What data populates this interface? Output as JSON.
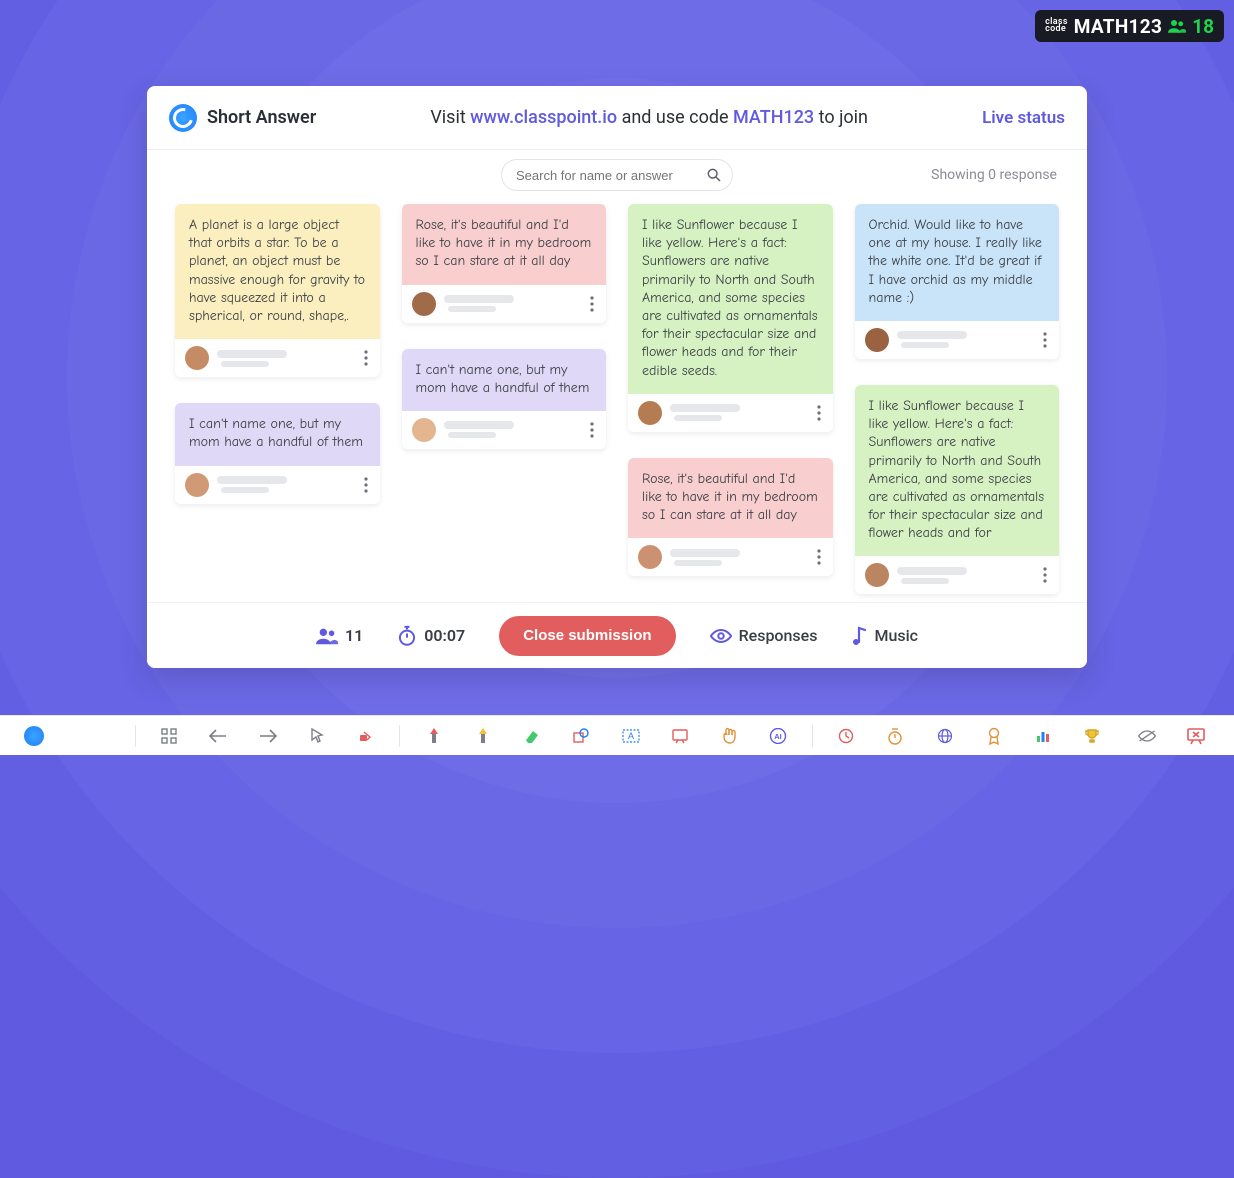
{
  "badge": {
    "label_top": "class",
    "label_bottom": "code",
    "code": "MATH123",
    "participants": "18"
  },
  "header": {
    "activity_title": "Short Answer",
    "instruction_prefix": "Visit ",
    "instruction_url": "www.classpoint.io",
    "instruction_mid": " and use code ",
    "instruction_code": "MATH123",
    "instruction_suffix": " to join",
    "live_status": "Live status"
  },
  "search": {
    "placeholder": "Search for name or answer",
    "showing_text": "Showing 0 response"
  },
  "responses": [
    {
      "color": "c-yellow",
      "text": "A planet is a large object that orbits a star. To be a planet, an object must be massive enough for gravity to have squeezed it into a spherical, or round, shape,."
    },
    {
      "color": "c-purple",
      "text": "I can't name one, but my mom have a handful of them"
    },
    {
      "color": "c-pink",
      "text": "Rose, it's beautiful and I'd like to have it in my bedroom so I can stare at it all day"
    },
    {
      "color": "c-purple",
      "text": "I can't name one, but my mom have a handful of them"
    },
    {
      "color": "c-green",
      "text": "I like Sunflower because I like yellow. Here's a fact: Sunflowers are native primarily to North and South America, and some species are cultivated as ornamentals for their spectacular size and flower heads and for their edible seeds."
    },
    {
      "color": "c-pink",
      "text": "Rose, it's beautiful and I'd like to have it in my bedroom so I can stare at it all day"
    },
    {
      "color": "c-blue",
      "text": "Orchid. Would like to have one at my house. I really like the white one. It'd be great if I have orchid as my middle name :)"
    },
    {
      "color": "c-green",
      "text": "I like Sunflower because I like yellow. Here's a fact: Sunflowers are native primarily to North and South America, and some species are cultivated as ornamentals for their spectacular size and flower heads and for"
    }
  ],
  "bottom": {
    "participant_count": "11",
    "timer": "00:07",
    "close_btn": "Close submission",
    "responses_label": "Responses",
    "music_label": "Music"
  },
  "colors": {
    "accent": "#5f5ae0",
    "danger": "#e25d5d",
    "success": "#1fd34c"
  }
}
